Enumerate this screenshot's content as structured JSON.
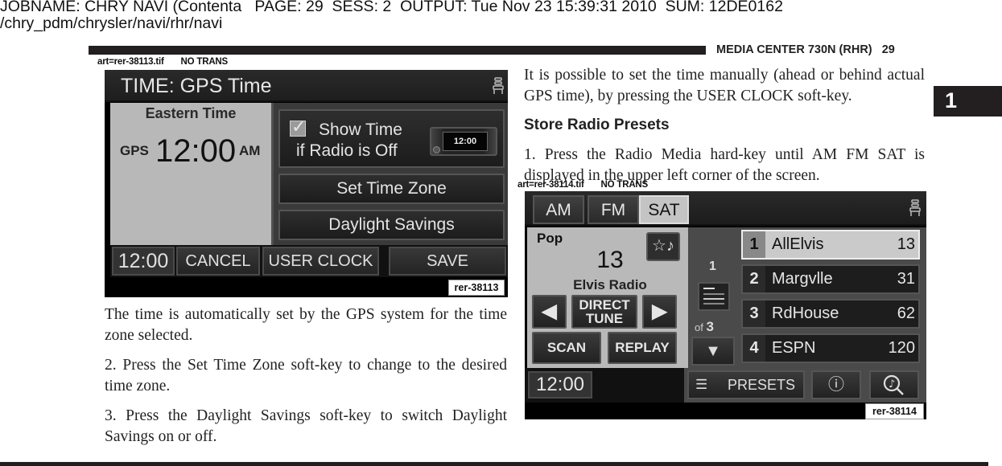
{
  "print_header": {
    "line1": "JOBNAME: CHRY NAVI (Contenta   PAGE: 29  SESS: 2  OUTPUT: Tue Nov 23 15:39:31 2010  SUM: 12DE0162",
    "line2": "/chry_pdm/chrysler/navi/rhr/navi"
  },
  "page_header": {
    "title": "MEDIA CENTER 730N (RHR)   29"
  },
  "chapter_tab": "1",
  "figure1": {
    "art_label": "art=rer-38113.tif       NO TRANS",
    "title": "TIME: GPS Time",
    "timezone": "Eastern Time",
    "gps_label": "GPS",
    "clock": "12:00",
    "ampm": "AM",
    "show_time_line1": "Show Time",
    "show_time_line2": "if Radio is Off",
    "show_time_checked": true,
    "mini_clock": "12:00",
    "set_time_zone": "Set Time Zone",
    "daylight_savings": "Daylight Savings",
    "bottom_time": "12:00",
    "cancel": "CANCEL",
    "user_clock": "USER CLOCK",
    "save": "SAVE",
    "ref": "rer-38113"
  },
  "left_text": {
    "p1": "The time is automatically set by the GPS system for the time zone selected.",
    "p2": "2. Press the Set Time Zone soft-key to change to the desired time zone.",
    "p3": "3. Press the Daylight Savings soft-key to switch Daylight Savings on or off."
  },
  "right_text": {
    "p1": "It is possible to set the time manually (ahead or behind actual GPS time), by pressing the USER CLOCK soft-key.",
    "heading": "Store Radio Presets",
    "p2": "1. Press the Radio Media hard-key until AM FM SAT is displayed in the upper left corner of the screen."
  },
  "figure2": {
    "art_label": "art=rer-38114.tif       NO TRANS",
    "tabs": [
      "AM",
      "FM",
      "SAT"
    ],
    "active_tab": "SAT",
    "genre": "Pop",
    "channel_number": "13",
    "channel_name": "Elvis Radio",
    "direct_tune_line1": "DIRECT",
    "direct_tune_line2": "TUNE",
    "scan": "SCAN",
    "replay": "REPLAY",
    "page_current": "1",
    "page_of_label": "of",
    "page_total": "3",
    "presets": [
      {
        "num": "1",
        "name": "AllElvis",
        "channel": "13",
        "selected": true
      },
      {
        "num": "2",
        "name": "Margvlle",
        "channel": "31",
        "selected": false
      },
      {
        "num": "3",
        "name": "RdHouse",
        "channel": "62",
        "selected": false
      },
      {
        "num": "4",
        "name": "ESPN",
        "channel": "120",
        "selected": false
      }
    ],
    "bottom_time": "12:00",
    "presets_button": "PRESETS",
    "ref": "rer-38114"
  },
  "icons": {
    "prev": "◀",
    "next": "▶",
    "down": "▼",
    "favorite": "☆♪",
    "info": "ⓘ",
    "presets_list": "☰",
    "music_search": "♪"
  }
}
